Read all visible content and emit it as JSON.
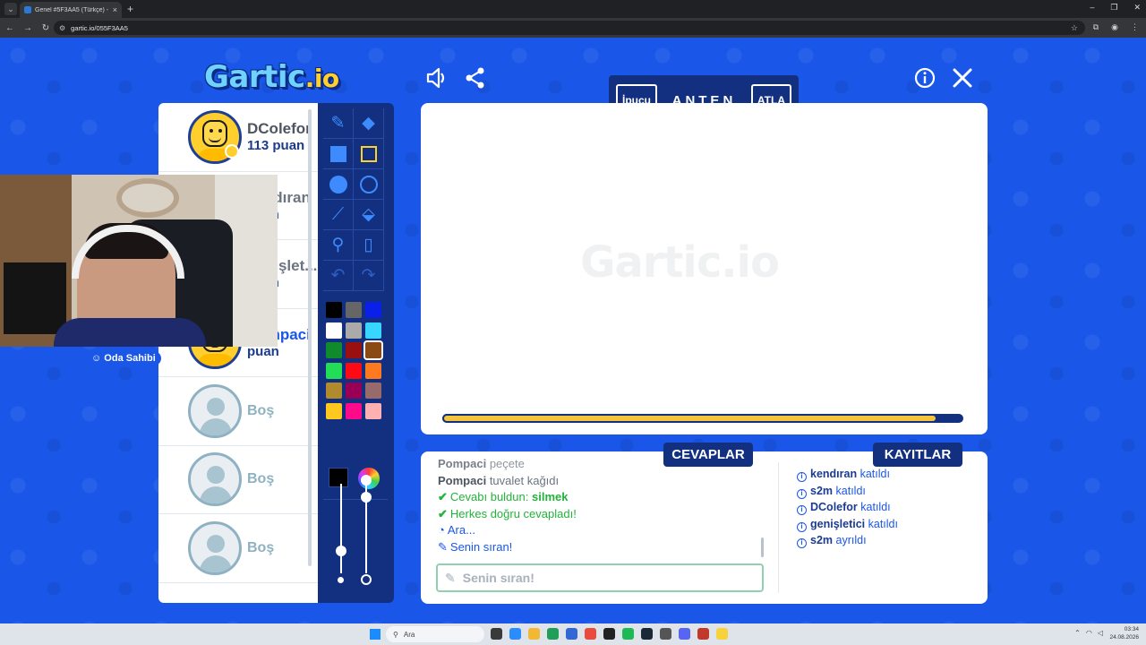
{
  "browser": {
    "tab_title": "Genel #5F3AA5 (Türkçe) - Gartic",
    "tab_close": "×",
    "new_tab": "+",
    "url": "gartic.io/055F3AA5",
    "window_controls": [
      "–",
      "❐",
      "✕"
    ]
  },
  "app": {
    "logo_main": "Gartic",
    "logo_suffix": ".io",
    "watermark": "Gartic.io"
  },
  "banner": {
    "hint_label": "İpucu",
    "word": "ANTEN",
    "skip_label": "ATLA"
  },
  "players": [
    {
      "name": "DColefor",
      "score": "113 puan",
      "type": "user"
    },
    {
      "name": "kendıran",
      "score": "puan",
      "type": "user"
    },
    {
      "name": "genişlet...",
      "score": "puan",
      "type": "user"
    },
    {
      "name": "Pompaci",
      "score": "puan",
      "type": "user"
    },
    {
      "name": "Boş",
      "type": "empty"
    },
    {
      "name": "Boş",
      "type": "empty"
    },
    {
      "name": "Boş",
      "type": "empty"
    }
  ],
  "owner_badge": "Oda Sahibi",
  "tools": [
    {
      "icon": "pencil-icon",
      "glyph": "✎",
      "state": "normal"
    },
    {
      "icon": "eraser-icon",
      "glyph": "◆",
      "state": "normal"
    },
    {
      "icon": "filled-rectangle-icon",
      "glyph": "",
      "state": "normal"
    },
    {
      "icon": "outline-rectangle-icon",
      "glyph": "",
      "state": "selected"
    },
    {
      "icon": "filled-circle-icon",
      "glyph": "",
      "state": "normal"
    },
    {
      "icon": "outline-circle-icon",
      "glyph": "",
      "state": "normal"
    },
    {
      "icon": "line-icon",
      "glyph": "⟋",
      "state": "normal"
    },
    {
      "icon": "fill-bucket-icon",
      "glyph": "⬙",
      "state": "normal"
    },
    {
      "icon": "eyedropper-icon",
      "glyph": "⚲",
      "state": "normal"
    },
    {
      "icon": "new-page-icon",
      "glyph": "▯",
      "state": "normal"
    },
    {
      "icon": "undo-icon",
      "glyph": "↶",
      "state": "dim"
    },
    {
      "icon": "redo-icon",
      "glyph": "↷",
      "state": "dim"
    }
  ],
  "palette": [
    "#000000",
    "#666666",
    "#0a20e8",
    "#ffffff",
    "#aaaaaa",
    "#38d5ff",
    "#0f8a2c",
    "#991010",
    "#8a4a14",
    "#22dd55",
    "#ff0a14",
    "#ff7a1e",
    "#b08a2c",
    "#990055",
    "#996a6a",
    "#ffc81e",
    "#ff0a8a",
    "#ffb0b0"
  ],
  "selected_color": "#000000",
  "selected_palette_index": 8,
  "brush_size": 0.25,
  "opacity": 0.85,
  "round_timer_remaining": 0.95,
  "sections": {
    "answers_tab": "CEVAPLAR",
    "logs_tab": "KAYITLAR"
  },
  "answers": [
    {
      "user": "Pompaci",
      "text": "peçete",
      "kind": "guess"
    },
    {
      "user": "Pompaci",
      "text": "tuvalet kağıdı",
      "kind": "guess"
    },
    {
      "prefix": "Cevabı buldun:",
      "text": "silmek",
      "kind": "correct"
    },
    {
      "text": "Herkes doğru cevapladı!",
      "kind": "correct-all"
    },
    {
      "text": "Ara...",
      "kind": "info"
    },
    {
      "text": "Senin sıran!",
      "kind": "turn"
    }
  ],
  "answer_input_placeholder": "Senin sıran!",
  "logs": [
    {
      "user": "kendıran",
      "action": "katıldı"
    },
    {
      "user": "s2m",
      "action": "katıldı"
    },
    {
      "user": "DColefor",
      "action": "katıldı"
    },
    {
      "user": "genişletici",
      "action": "katıldı"
    },
    {
      "user": "s2m",
      "action": "ayrıldı"
    }
  ],
  "taskbar": {
    "search_placeholder": "Ara",
    "time": "03:34",
    "date": "24.08.2026"
  }
}
